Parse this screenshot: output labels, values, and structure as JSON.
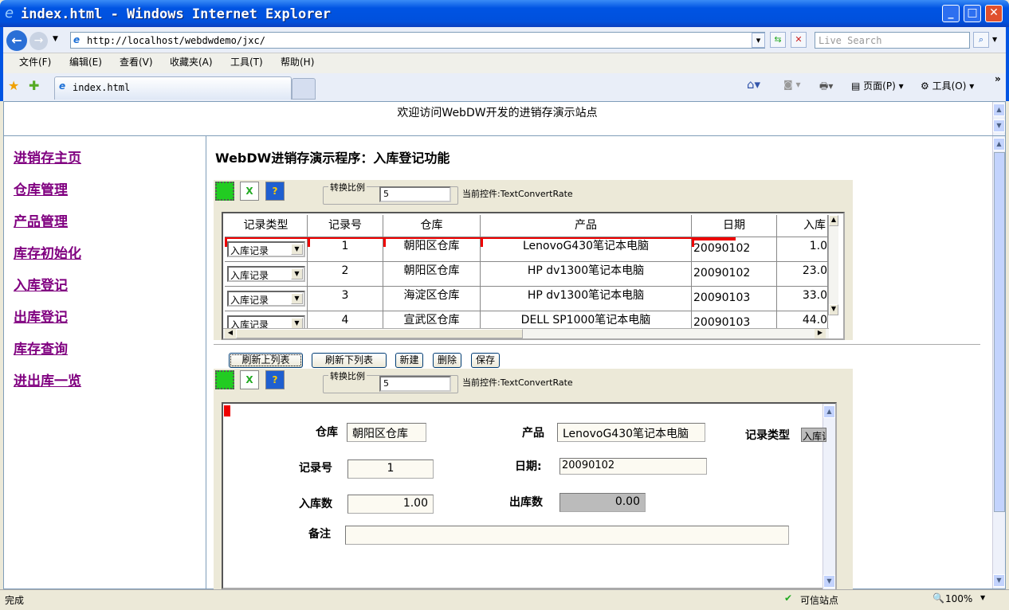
{
  "window": {
    "title": "index.html - Windows Internet Explorer",
    "min": "_",
    "max": "□",
    "close": "✕"
  },
  "address": {
    "url": "http://localhost/webdwdemo/jxc/",
    "search_placeholder": "Live Search"
  },
  "menu": [
    "文件(F)",
    "编辑(E)",
    "查看(V)",
    "收藏夹(A)",
    "工具(T)",
    "帮助(H)"
  ],
  "tab": {
    "label": "index.html"
  },
  "commandbar": {
    "page": "页面(P)",
    "tools": "工具(O)"
  },
  "top_frame": {
    "welcome": "欢迎访问WebDW开发的进销存演示站点"
  },
  "nav": [
    "进销存主页",
    "仓库管理",
    "产品管理",
    "库存初始化",
    "入库登记",
    "出库登记",
    "库存查询",
    "进出库一览"
  ],
  "main": {
    "heading": "WebDW进销存演示程序：入库登记功能"
  },
  "panel_top": {
    "group_label": "转换比例",
    "rate": "5",
    "current_control": "当前控件:TextConvertRate"
  },
  "grid": {
    "columns": [
      "记录类型",
      "记录号",
      "仓库",
      "产品",
      "日期",
      "入库"
    ],
    "rows": [
      {
        "type": "入库记录",
        "no": "1",
        "warehouse": "朝阳区仓库",
        "product": "LenovoG430笔记本电脑",
        "date": "20090102",
        "in": "1.0"
      },
      {
        "type": "入库记录",
        "no": "2",
        "warehouse": "朝阳区仓库",
        "product": "HP dv1300笔记本电脑",
        "date": "20090102",
        "in": "23.0"
      },
      {
        "type": "入库记录",
        "no": "3",
        "warehouse": "海淀区仓库",
        "product": "HP dv1300笔记本电脑",
        "date": "20090103",
        "in": "33.0"
      },
      {
        "type": "入库记录",
        "no": "4",
        "warehouse": "宣武区仓库",
        "product": "DELL SP1000笔记本电脑",
        "date": "20090103",
        "in": "44.0"
      }
    ]
  },
  "buttons": {
    "refresh_upper": "刷新上列表",
    "refresh_lower": "刷新下列表",
    "new": "新建",
    "delete": "删除",
    "save": "保存"
  },
  "panel_bottom": {
    "group_label": "转换比例",
    "rate": "5",
    "current_control": "当前控件:TextConvertRate"
  },
  "form": {
    "warehouse_label": "仓库",
    "warehouse": "朝阳区仓库",
    "product_label": "产品",
    "product": "LenovoG430笔记本电脑",
    "type_label": "记录类型",
    "type": "入库记",
    "no_label": "记录号",
    "no": "1",
    "date_label": "日期:",
    "date": "20090102",
    "in_label": "入库数",
    "in": "1.00",
    "out_label": "出库数",
    "out": "0.00",
    "note_label": "备注",
    "note": ""
  },
  "status": {
    "text": "完成",
    "zone": "可信站点",
    "zoom": "100%"
  }
}
